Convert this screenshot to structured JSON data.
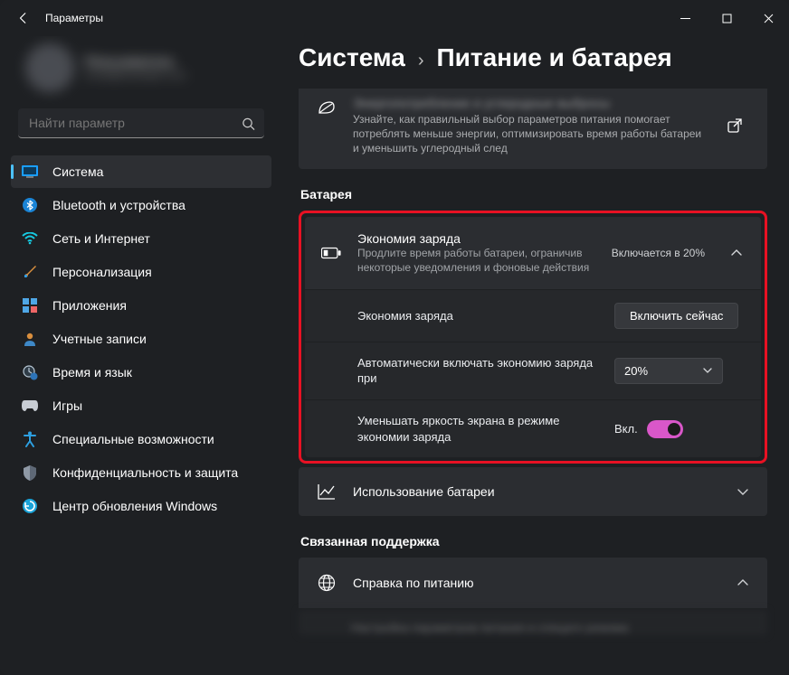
{
  "titlebar": {
    "title": "Параметры"
  },
  "profile": {
    "name": "Пользователь",
    "email": "email@example.com"
  },
  "search": {
    "placeholder": "Найти параметр"
  },
  "sidebar": {
    "items": [
      {
        "label": "Система"
      },
      {
        "label": "Bluetooth и устройства"
      },
      {
        "label": "Сеть и Интернет"
      },
      {
        "label": "Персонализация"
      },
      {
        "label": "Приложения"
      },
      {
        "label": "Учетные записи"
      },
      {
        "label": "Время и язык"
      },
      {
        "label": "Игры"
      },
      {
        "label": "Специальные возможности"
      },
      {
        "label": "Конфиденциальность и защита"
      },
      {
        "label": "Центр обновления Windows"
      }
    ]
  },
  "breadcrumb": {
    "parent": "Система",
    "sep": "›",
    "current": "Питание и батарея"
  },
  "energy_card": {
    "title": "Энергопотребление и углеродные выбросы",
    "desc": "Узнайте, как правильный выбор параметров питания помогает потреблять меньше энергии, оптимизировать время работы батареи и уменьшить углеродный след"
  },
  "sections": {
    "battery": "Батарея",
    "related": "Связанная поддержка"
  },
  "battery_saver": {
    "title": "Экономия заряда",
    "desc": "Продлите время работы батареи, ограничив некоторые уведомления и фоновые действия",
    "status": "Включается в 20%",
    "row1_label": "Экономия заряда",
    "row1_button": "Включить сейчас",
    "row2_label": "Автоматически включать экономию заряда при",
    "row2_value": "20%",
    "row3_label": "Уменьшать яркость экрана в режиме экономии заряда",
    "row3_toggle_label": "Вкл."
  },
  "usage": {
    "label": "Использование батареи"
  },
  "help": {
    "label": "Справка по питанию"
  },
  "cut_bottom": "Настройка параметров питания и спящего режима"
}
